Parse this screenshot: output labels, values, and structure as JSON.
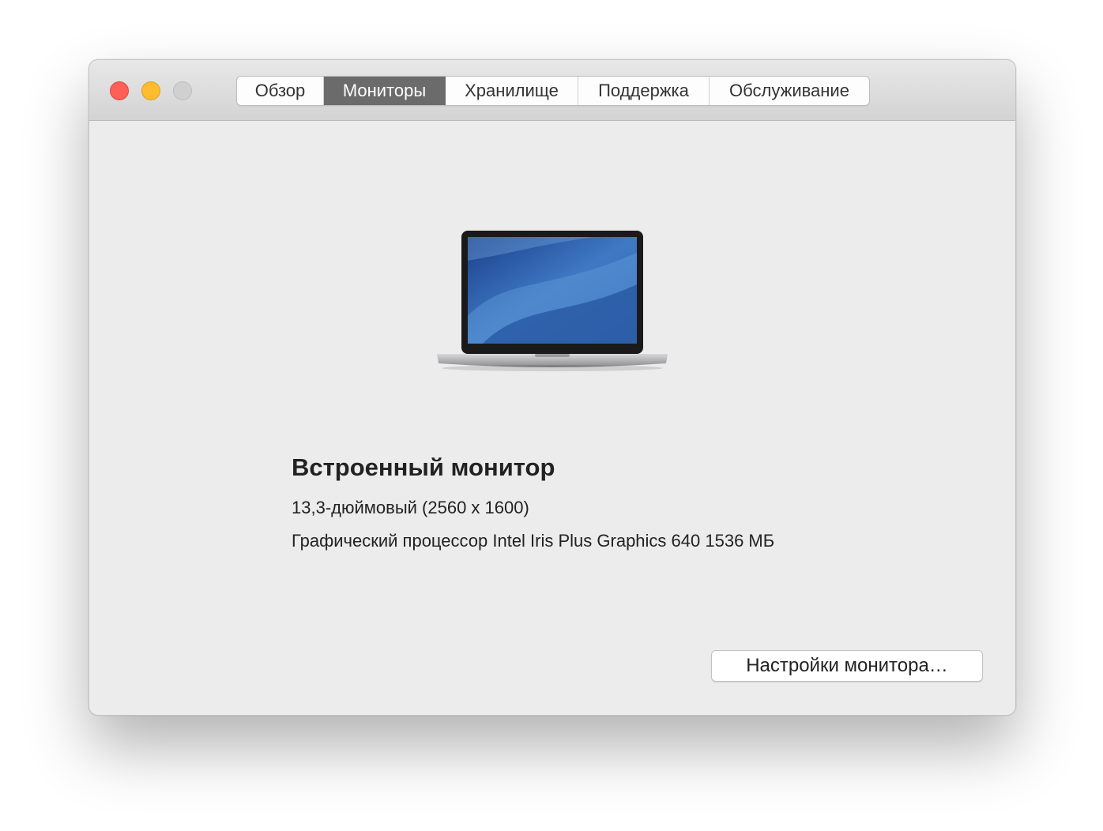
{
  "window": {
    "traffic_lights": {
      "close_color": "#fe5f57",
      "minimize_color": "#febc2e",
      "zoom_color": "#d0d0d0"
    },
    "tabs": [
      {
        "label": "Обзор",
        "active": false
      },
      {
        "label": "Мониторы",
        "active": true
      },
      {
        "label": "Хранилище",
        "active": false
      },
      {
        "label": "Поддержка",
        "active": false
      },
      {
        "label": "Обслуживание",
        "active": false
      }
    ]
  },
  "display": {
    "image_icon": "macbook-laptop-icon",
    "name": "Встроенный монитор",
    "size_resolution": "13,3-дюймовый (2560 x 1600)",
    "gpu": "Графический процессор Intel Iris Plus Graphics 640 1536 МБ",
    "settings_button": "Настройки монитора…"
  },
  "colors": {
    "active_tab": "#6b6b6b",
    "window_bg": "#ececec"
  }
}
